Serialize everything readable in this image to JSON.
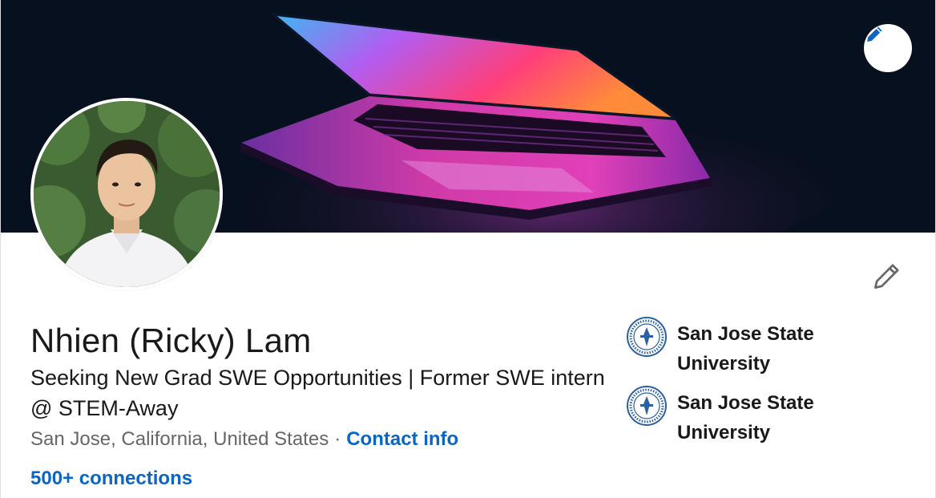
{
  "profile": {
    "name": "Nhien (Ricky) Lam",
    "headline": "Seeking New Grad SWE Opportunities | Former SWE intern @ STEM-Away",
    "location": "San Jose, California, United States",
    "separator": "·",
    "contact_info_label": "Contact info",
    "connections_label": "500+ connections"
  },
  "education": [
    {
      "name": "San Jose State University",
      "logo_icon": "sjsu-seal-icon"
    },
    {
      "name": "San Jose State University",
      "logo_icon": "sjsu-seal-icon"
    }
  ],
  "icons": {
    "banner_edit": "pencil-icon",
    "intro_edit": "pencil-outline-icon"
  },
  "colors": {
    "link": "#0a66c2",
    "text": "#191919",
    "muted": "#666666",
    "banner_bg": "#07101e"
  }
}
